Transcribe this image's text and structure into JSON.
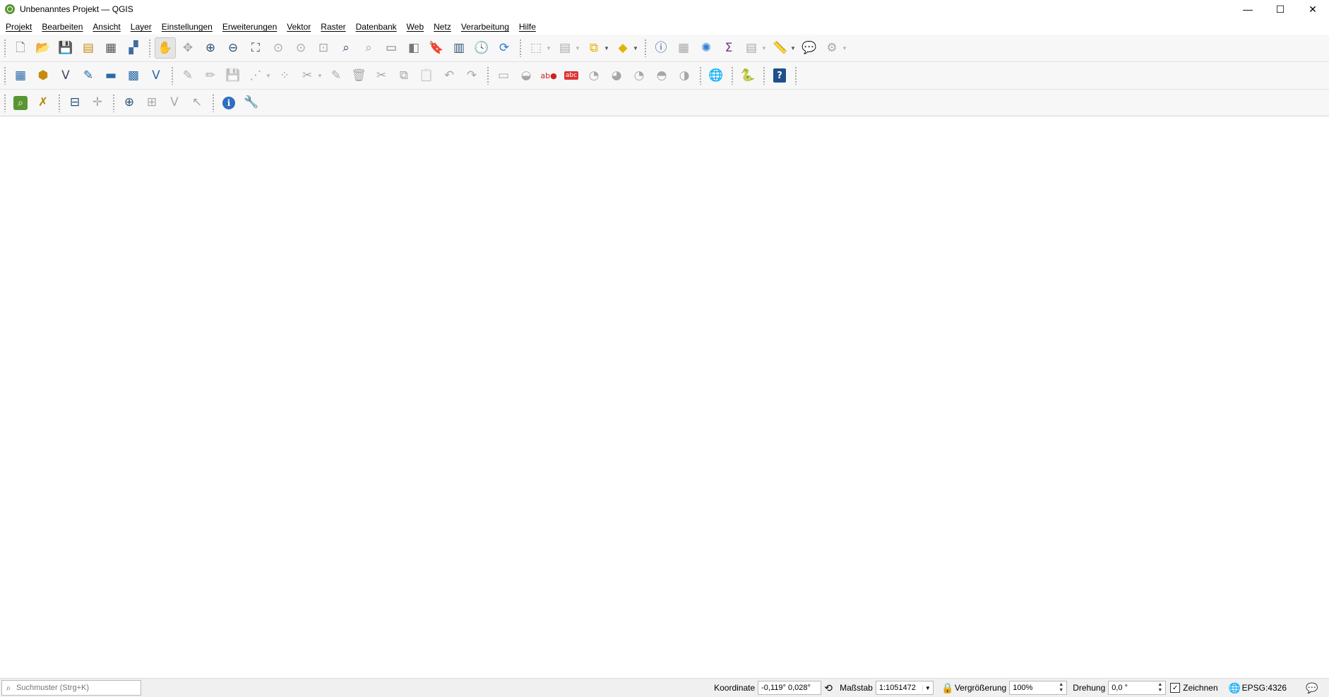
{
  "window": {
    "title": "Unbenanntes Projekt — QGIS",
    "minimize": "—",
    "maximize": "☐",
    "close": "✕"
  },
  "menu": [
    "Projekt",
    "Bearbeiten",
    "Ansicht",
    "Layer",
    "Einstellungen",
    "Erweiterungen",
    "Vektor",
    "Raster",
    "Datenbank",
    "Web",
    "Netz",
    "Verarbeitung",
    "Hilfe"
  ],
  "toolbar_icons": {
    "row1": [
      "new-project-icon",
      "open-project-icon",
      "save-project-icon",
      "print-layout-icon",
      "layout-manager-icon",
      "style-manager-icon",
      "pan-icon",
      "pan-to-selection-icon",
      "zoom-in-icon",
      "zoom-out-icon",
      "zoom-full-icon",
      "zoom-to-selection-icon",
      "zoom-to-layer-icon",
      "zoom-native-icon",
      "zoom-last-icon",
      "zoom-next-icon",
      "new-map-view-icon",
      "new-3d-view-icon",
      "new-bookmark-icon",
      "show-bookmarks-icon",
      "temporal-controller-icon",
      "refresh-icon",
      "select-features-icon",
      "select-by-value-icon",
      "deselect-icon",
      "select-location-icon",
      "identify-icon",
      "attribute-table-icon",
      "field-calculator-icon",
      "statistics-icon",
      "open-table-icon",
      "measure-icon",
      "map-tips-icon",
      "annotation-icon"
    ],
    "row2": [
      "data-source-manager-icon",
      "new-geopackage-layer-icon",
      "new-shapefile-layer-icon",
      "new-spatialite-layer-icon",
      "new-virtual-layer-icon",
      "new-temporary-layer-icon",
      "virtual-layer-icon",
      "current-edits-icon",
      "toggle-editing-icon",
      "save-edits-icon",
      "digitize-icon",
      "vertex-tool-icon",
      "delete-selected-icon",
      "cut-icon",
      "copy-icon",
      "paste-icon",
      "undo-icon",
      "redo-icon",
      "label-toolbar-icon",
      "pin-labels-icon",
      "highlight-labels-icon",
      "label-abc-icon",
      "show-hide-labels-icon",
      "move-label-icon",
      "rotate-label-icon",
      "change-label-icon",
      "globe-plugin-icon",
      "python-console-icon",
      "help-icon"
    ],
    "row3": [
      "metasearch-icon",
      "georeferencer-icon",
      "cad-tools-icon",
      "snapping-icon",
      "digitize-with-segment-icon",
      "add-ring-icon",
      "fill-ring-icon",
      "offset-curve-icon",
      "info-icon",
      "settings-wrench-icon"
    ]
  },
  "status": {
    "search_placeholder": "Suchmuster (Strg+K)",
    "coordinate_label": "Koordinate",
    "coordinate_value": "-0,119° 0,028°",
    "scale_label": "Maßstab",
    "scale_value": "1:1051472",
    "magnifier_label": "Vergrößerung",
    "magnifier_value": "100%",
    "rotation_label": "Drehung",
    "rotation_value": "0,0 °",
    "render_label": "Zeichnen",
    "crs": "EPSG:4326"
  },
  "colors": {
    "qgis_green": "#589632",
    "toolbar_bg": "#f7f7f7",
    "statusbar_bg": "#f0f0f0"
  }
}
